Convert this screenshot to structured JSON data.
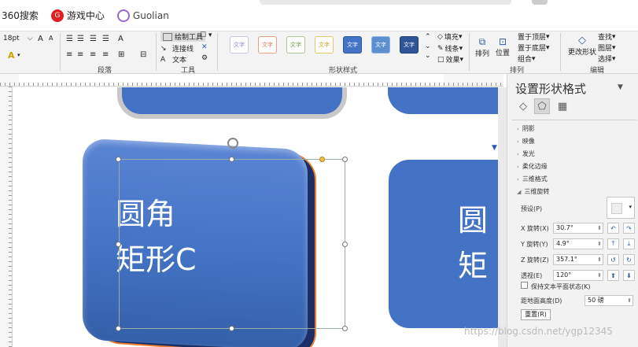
{
  "bookmarks": [
    {
      "label": "360搜索",
      "icon": "none",
      "color": ""
    },
    {
      "label": "游戏中心",
      "icon": "360-game-icon",
      "color": "#e02020"
    },
    {
      "label": "Guolian",
      "icon": "guolian-icon",
      "color": "#9a6bc6"
    }
  ],
  "ribbon": {
    "font_size": "18pt",
    "groups": {
      "paragraph": "段落",
      "tools": "工具",
      "shape_styles": "形状样式",
      "arrange": "排列",
      "edit": "编辑"
    },
    "tools": {
      "textbox": "绘制工具",
      "connector": "连接线",
      "text": "文本"
    },
    "style_label": "文字",
    "fill": "填充",
    "line": "线条",
    "effect": "效果",
    "arrange": "排列",
    "position": "位置",
    "bring_front": "置于顶层",
    "send_back": "置于底层",
    "group": "组合",
    "change_shape": "更改形状",
    "find": "查找",
    "select": "选择",
    "layer": "图层"
  },
  "canvas": {
    "main_shape_text_line1": "圆角",
    "main_shape_text_line2": "矩形C",
    "right_shape_text_line1": "圆",
    "right_shape_text_line2": "矩"
  },
  "panel": {
    "title": "设置形状格式",
    "sections": [
      "阴影",
      "映像",
      "发光",
      "柔化边缘",
      "三维格式",
      "三维旋转"
    ],
    "preset_label": "预设(P)",
    "x_label": "X 旋转(X)",
    "x_value": "30.7°",
    "y_label": "Y 旋转(Y)",
    "y_value": "4.9°",
    "z_label": "Z 旋转(Z)",
    "z_value": "357.1°",
    "persp_label": "透视(E)",
    "persp_value": "120°",
    "keep_text_flat": "保持文本平面状态(K)",
    "distance_label": "距地面高度(D)",
    "distance_value": "50 磅",
    "reset": "重置(R)"
  },
  "watermark": "https://blog.csdn.net/ygp12345"
}
